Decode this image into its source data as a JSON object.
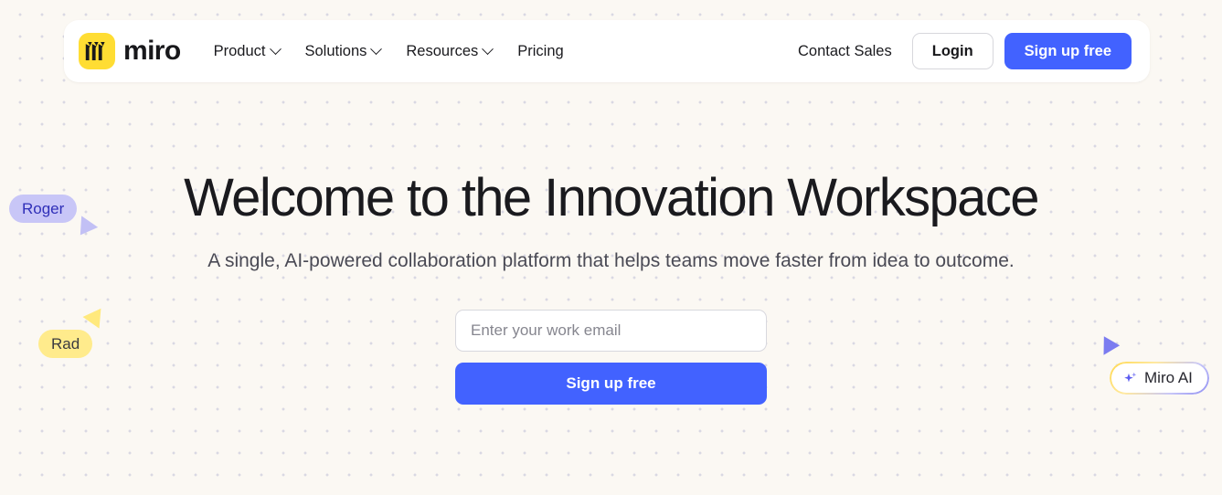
{
  "brand": {
    "name": "miro",
    "logo_icon": "miro-logo-icon",
    "logo_bg": "#ffdd33"
  },
  "nav": {
    "links": [
      {
        "label": "Product",
        "has_chevron": true,
        "icon": "chevron-down-icon"
      },
      {
        "label": "Solutions",
        "has_chevron": true,
        "icon": "chevron-down-icon"
      },
      {
        "label": "Resources",
        "has_chevron": true,
        "icon": "chevron-down-icon"
      },
      {
        "label": "Pricing",
        "has_chevron": false,
        "icon": ""
      }
    ],
    "contact_sales": "Contact Sales",
    "login": "Login",
    "signup": "Sign up free"
  },
  "hero": {
    "title": "Welcome to the Innovation Workspace",
    "subtitle": "A single, AI-powered collaboration platform that helps teams move faster from idea to outcome.",
    "email_placeholder": "Enter your work email",
    "email_value": "",
    "cta": "Sign up free"
  },
  "cursors": [
    {
      "label": "Roger",
      "pill_color": "#c8c6f7",
      "text_color": "#2f2fb8",
      "arrow_color": "#c2c0f5"
    },
    {
      "label": "Rad",
      "pill_color": "#ffeb8c",
      "text_color": "#3a3a40",
      "arrow_color": "#ffe97d"
    },
    {
      "label": "Miro AI",
      "pill_color": "#ffffff",
      "text_color": "#26262e",
      "arrow_color": "#7b7cf0",
      "icon": "sparkle-icon"
    }
  ],
  "colors": {
    "page_bg": "#fbf8f3",
    "dot_grid": "#d9d8e3",
    "accent_blue": "#4262ff",
    "brand_yellow": "#ffdd33",
    "text_dark": "#1a1a1e"
  }
}
